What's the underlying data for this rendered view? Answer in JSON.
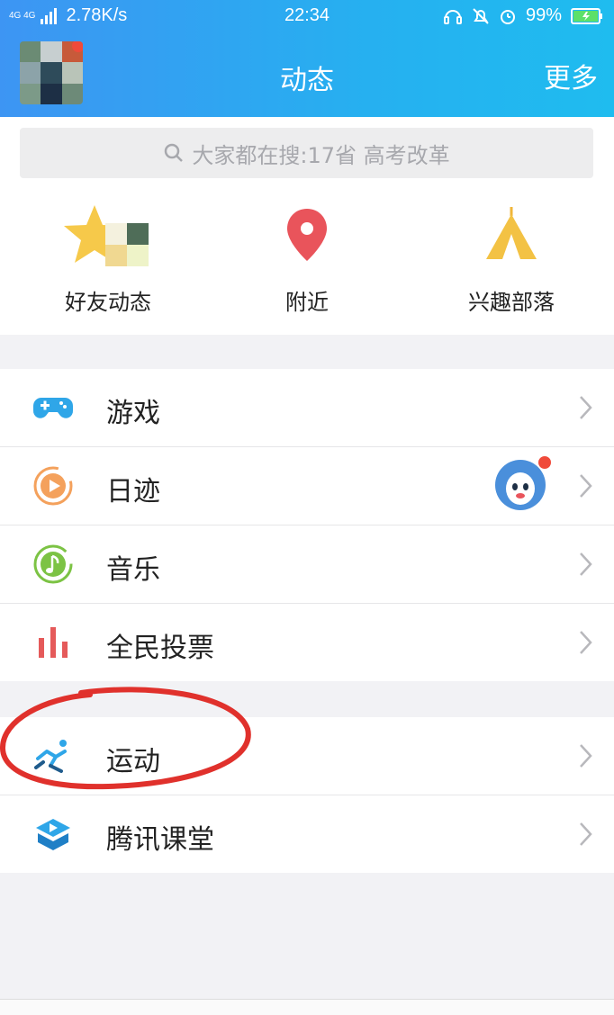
{
  "status_bar": {
    "network": "4G 4G",
    "speed": "2.78K/s",
    "time": "22:34",
    "battery": "99%"
  },
  "header": {
    "title": "动态",
    "more_label": "更多"
  },
  "search": {
    "placeholder": "大家都在搜:17省 高考改革"
  },
  "quick_links": [
    {
      "label": "好友动态",
      "icon": "star-icon"
    },
    {
      "label": "附近",
      "icon": "location-pin-icon"
    },
    {
      "label": "兴趣部落",
      "icon": "tent-icon"
    }
  ],
  "menu_section_1": [
    {
      "label": "游戏",
      "icon": "gamepad-icon"
    },
    {
      "label": "日迹",
      "icon": "play-circle-icon"
    },
    {
      "label": "音乐",
      "icon": "music-note-icon"
    },
    {
      "label": "全民投票",
      "icon": "bar-chart-icon"
    }
  ],
  "menu_section_2": [
    {
      "label": "运动",
      "icon": "running-icon"
    },
    {
      "label": "腾讯课堂",
      "icon": "classroom-icon"
    }
  ],
  "colors": {
    "header_gradient_start": "#3d95f3",
    "header_gradient_end": "#1fbcef",
    "badge_red": "#f04a3a",
    "annotation_red": "#e0312c"
  }
}
